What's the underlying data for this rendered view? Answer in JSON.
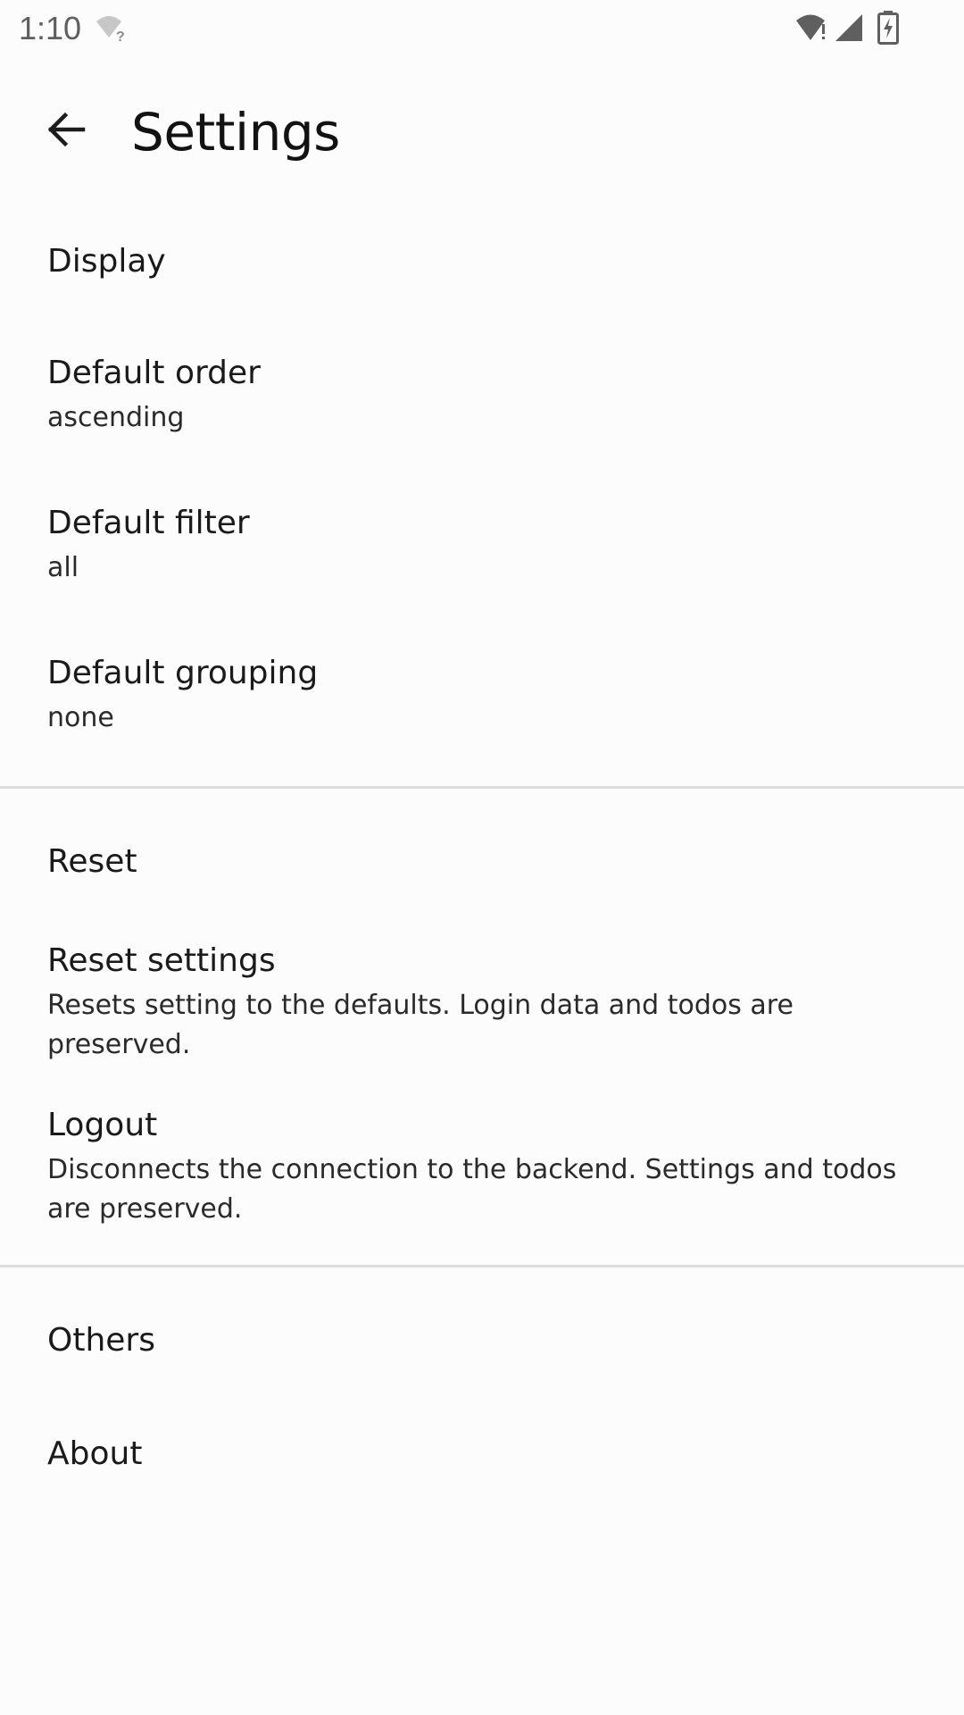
{
  "status_bar": {
    "time": "1:10",
    "icons": [
      "wifi-unknown-icon",
      "wifi-alert-icon",
      "cell-signal-icon",
      "battery-charging-icon"
    ]
  },
  "app_bar": {
    "back_icon": "arrow-back-icon",
    "title": "Settings"
  },
  "sections": {
    "display": {
      "header": "Display",
      "default_order": {
        "title": "Default order",
        "summary": "ascending"
      },
      "default_filter": {
        "title": "Default filter",
        "summary": "all"
      },
      "default_grouping": {
        "title": "Default grouping",
        "summary": "none"
      }
    },
    "reset": {
      "header": "Reset",
      "reset_settings": {
        "title": "Reset settings",
        "summary": "Resets setting to the defaults. Login data and todos are preserved."
      },
      "logout": {
        "title": "Logout",
        "summary": "Disconnects the connection to the backend. Settings and todos are preserved."
      }
    },
    "others": {
      "header": "Others",
      "about": {
        "title": "About"
      }
    }
  },
  "colors": {
    "background": "#fcfcfc",
    "text": "#1a1a1a",
    "divider": "#dedede",
    "status_icons": "#5f5f5f"
  }
}
